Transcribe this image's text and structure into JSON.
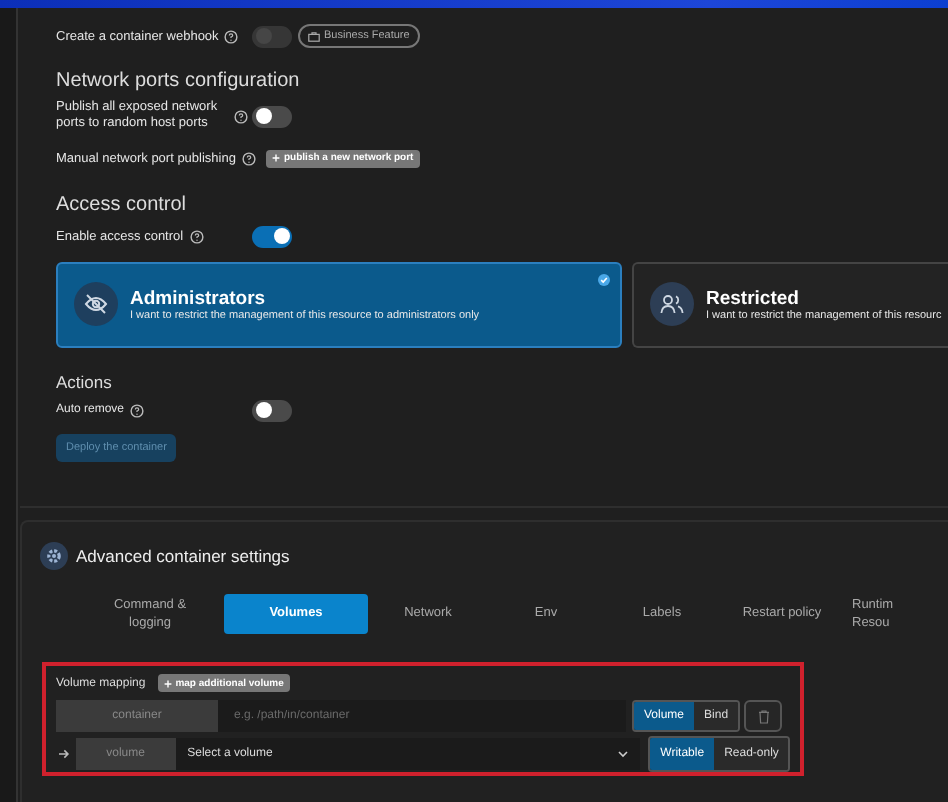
{
  "webhook": {
    "label": "Create a container webhook",
    "toggle": {
      "on": false,
      "disabled": true
    },
    "badge": "Business Feature"
  },
  "network": {
    "title": "Network ports configuration",
    "publish_all": {
      "label": "Publish all exposed network ports to random host ports",
      "on": false
    },
    "manual": {
      "label": "Manual network port publishing",
      "button": "publish a new network port"
    }
  },
  "access": {
    "title": "Access control",
    "enable": {
      "label": "Enable access control",
      "on": true
    },
    "cards": [
      {
        "kind": "admin",
        "title": "Administrators",
        "description": "I want to restrict the management of this resource to administrators only",
        "selected": true
      },
      {
        "kind": "restricted",
        "title": "Restricted",
        "description": "I want to restrict the management of this resourc",
        "selected": false
      }
    ]
  },
  "actions": {
    "title": "Actions",
    "auto_remove": {
      "label": "Auto remove",
      "on": false
    },
    "deploy": {
      "label": "Deploy the container",
      "disabled": true
    }
  },
  "advanced": {
    "title": "Advanced container settings",
    "tabs": [
      {
        "label": "Command & logging",
        "selected": false
      },
      {
        "label": "Volumes",
        "selected": true
      },
      {
        "label": "Network",
        "selected": false
      },
      {
        "label": "Env",
        "selected": false
      },
      {
        "label": "Labels",
        "selected": false
      },
      {
        "label": "Restart policy",
        "selected": false
      },
      {
        "label": "Runtim Resou",
        "selected": false
      }
    ],
    "volume_mapping": {
      "label": "Volume mapping",
      "button": "map additional volume",
      "container": {
        "label": "container",
        "placeholder": "e.g. /path/in/container"
      },
      "type_options": [
        {
          "label": "Volume",
          "selected": true
        },
        {
          "label": "Bind",
          "selected": false
        }
      ],
      "volume": {
        "label": "volume",
        "value": "Select a volume"
      },
      "access_options": [
        {
          "label": "Writable",
          "selected": true
        },
        {
          "label": "Read-only",
          "selected": false
        }
      ]
    }
  }
}
